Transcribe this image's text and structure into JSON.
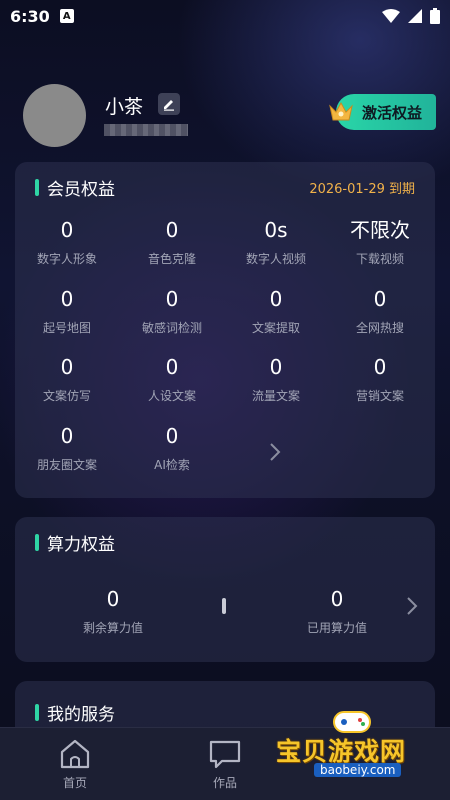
{
  "status_bar": {
    "time": "6:30",
    "notification_glyph": "A"
  },
  "profile": {
    "name": "小茶",
    "activate_label": "激活权益"
  },
  "member_card": {
    "title": "会员权益",
    "expiry": "2026-01-29 到期",
    "items": [
      {
        "value": "0",
        "label": "数字人形象"
      },
      {
        "value": "0",
        "label": "音色克隆"
      },
      {
        "value": "0s",
        "label": "数字人视频"
      },
      {
        "value": "不限次",
        "label": "下载视频"
      },
      {
        "value": "0",
        "label": "起号地图"
      },
      {
        "value": "0",
        "label": "敏感词检测"
      },
      {
        "value": "0",
        "label": "文案提取"
      },
      {
        "value": "0",
        "label": "全网热搜"
      },
      {
        "value": "0",
        "label": "文案仿写"
      },
      {
        "value": "0",
        "label": "人设文案"
      },
      {
        "value": "0",
        "label": "流量文案"
      },
      {
        "value": "0",
        "label": "营销文案"
      },
      {
        "value": "0",
        "label": "朋友圈文案"
      },
      {
        "value": "0",
        "label": "AI检索"
      }
    ]
  },
  "compute_card": {
    "title": "算力权益",
    "remaining": {
      "value": "0",
      "label": "剩余算力值"
    },
    "used": {
      "value": "0",
      "label": "已用算力值"
    }
  },
  "services_card": {
    "title": "我的服务"
  },
  "tabbar": {
    "tabs": [
      {
        "label": "首页",
        "icon": "home-icon"
      },
      {
        "label": "作品",
        "icon": "chat-icon"
      }
    ]
  },
  "watermark": {
    "text": "宝贝游戏网",
    "url": "baobeiy.com"
  },
  "colors": {
    "accent": "#2fd5a5",
    "expiry": "#f1b24a",
    "activate": "#29d6a8"
  }
}
